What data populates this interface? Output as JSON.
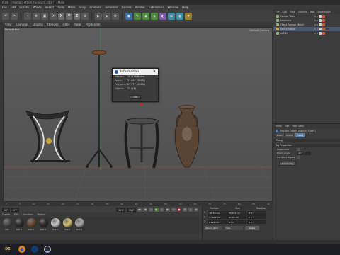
{
  "window": {
    "title": "R19) - [Roman_stand_furniture.c4d *] - Main"
  },
  "menubar": [
    "File",
    "Edit",
    "Create",
    "Modes",
    "Select",
    "Tools",
    "Mesh",
    "Snap",
    "Animate",
    "Simulate",
    "Tracker",
    "Render",
    "Extensions",
    "Window",
    "Help"
  ],
  "toolbar": {
    "undo_icon": "undo-icon",
    "items": [
      "X",
      "Y",
      "Z"
    ]
  },
  "viewport": {
    "menu": [
      "View",
      "Cameras",
      "Display",
      "Options",
      "Filter",
      "Panel",
      "ProRender"
    ],
    "label": "Perspective",
    "camera_label": "Default Camera"
  },
  "info_dialog": {
    "title": "Information",
    "rows": [
      {
        "key": "Meshes:",
        "value": "16 (148 Bytes)"
      },
      {
        "key": "Points:",
        "value": "27 697 (380 K)"
      },
      {
        "key": "Polygons:",
        "value": "27 277 (499 K)"
      },
      {
        "key": "Objects:",
        "value": "22 (18)"
      }
    ],
    "ok_label": "OK"
  },
  "timeline": {
    "ticks": [
      "0",
      "5",
      "10",
      "15",
      "20",
      "25",
      "30",
      "35",
      "40",
      "45",
      "50",
      "55",
      "60",
      "65",
      "70",
      "75",
      "80",
      "85",
      "90"
    ]
  },
  "transport": {
    "start": "0 F",
    "current": "0 F",
    "end": "90 F",
    "end2": "90 F"
  },
  "materials": {
    "menu": [
      "Create",
      "Edit",
      "Function",
      "Texture"
    ],
    "items": [
      {
        "label": "Mat",
        "color": "#4a4a4a"
      },
      {
        "label": "Mat.1",
        "color": "#2b2b2b"
      },
      {
        "label": "Mat.2",
        "color": "#6a4a2c"
      },
      {
        "label": "Mat.3",
        "color": "#2c2a26"
      },
      {
        "label": "Mat.4",
        "color": "#c9c9c9"
      },
      {
        "label": "Mat.5",
        "color": "#d8c270"
      },
      {
        "label": "Mat.6",
        "color": "#aaaaaa"
      }
    ]
  },
  "coordinates": {
    "headers": [
      "Position",
      "Size",
      "Rotation"
    ],
    "rows": [
      {
        "axis": "X",
        "pos": "-68.58 cm",
        "size": "75.437 cm",
        "rot": "H 0 °"
      },
      {
        "axis": "Y",
        "pos": "37.891 cm",
        "size": "67.25 cm",
        "rot": "P 0 °"
      },
      {
        "axis": "Z",
        "pos": "0.001 cm",
        "size": "0 cm",
        "rot": "B 0 °"
      }
    ],
    "mode": "Object (Rel)",
    "size_mode": "Size",
    "apply_label": "Apply"
  },
  "object_manager": {
    "menu": [
      "File",
      "Edit",
      "View",
      "Objects",
      "Tags",
      "Bookmarks"
    ],
    "objects": [
      {
        "name": "Roman Table",
        "color": "#9ab07a",
        "tags": [
          "#cfcfcf",
          "#d05a3a",
          "#3a3a3a"
        ]
      },
      {
        "name": "Amphora",
        "color": "#9ab07a",
        "tags": [
          "#cfcfcf",
          "#d05a3a",
          "#3a3a3a"
        ]
      },
      {
        "name": "Chest Roman Metal",
        "color": "#9ab07a",
        "tags": [
          "#cfcfcf",
          "#d05a3a",
          "#3a3a3a"
        ]
      },
      {
        "name": "Bailey stand",
        "color": "#d0a840",
        "tags": [
          "#cfcfcf",
          "#d05a3a",
          "#3a3a3a"
        ]
      },
      {
        "name": "LeT-10",
        "color": "#9ab07a",
        "tags": [
          "#cfcfcf",
          "#d05a3a",
          "#3a3a3a"
        ]
      }
    ],
    "selected_index": 3
  },
  "attribute_manager": {
    "menu": [
      "Mode",
      "Edit",
      "User Data"
    ],
    "object_line": "Polygon Object [Roman Stand]",
    "tabs": [
      "Basic",
      "Coord.",
      "Phong"
    ],
    "active_tab": "Phong",
    "section": "Phong",
    "section2": "Tag Properties",
    "props": [
      {
        "key": "Angle Limit",
        "value": "",
        "type": "check",
        "checked": "✓"
      },
      {
        "key": "Phong Angle",
        "value": "40 °",
        "type": "field"
      },
      {
        "key": "Use Edge Breaks",
        "value": "",
        "type": "check",
        "checked": "✓"
      }
    ],
    "button_label": "Delete Tag"
  },
  "taskbar": {
    "apps": [
      {
        "label": "DS",
        "icon": "daz-studio-icon"
      },
      {
        "label": "",
        "icon": "blender-icon"
      },
      {
        "label": "",
        "icon": "cinema4d-icon"
      },
      {
        "label": "",
        "icon": "cinema4d-active-icon"
      }
    ]
  }
}
